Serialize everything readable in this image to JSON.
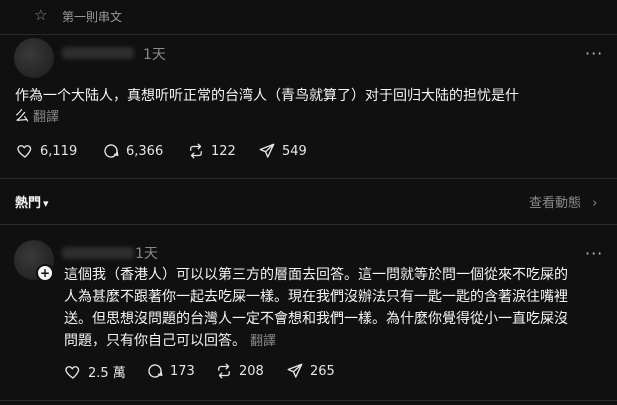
{
  "topbar": {
    "first_label": "第一則串文"
  },
  "post": {
    "time": "1天",
    "more": "···",
    "text_line1": "作為一个大陆人，真想听听正常的台湾人（青鸟就算了）对于回归大陆的担忧是什",
    "text_line2": "么",
    "translate": "翻譯",
    "likes": "6,119",
    "comments": "6,366",
    "reposts": "122",
    "shares": "549"
  },
  "sort": {
    "label": "熱門",
    "view_activity": "查看動態"
  },
  "reply": {
    "time": "1天",
    "text_line1": "這個我（香港人）可以以第三方的層面去回答。這一問就等於問一個從來不吃屎的",
    "text_line2": "人為甚麼不跟著你一起去吃屎一樣。現在我們沒辦法只有一匙一匙的含著淚往嘴裡",
    "text_line3": "送。但思想沒問題的台灣人一定不會想和我們一樣。為什麼你覺得從小一直吃屎沒",
    "text_line4": "問題，只有你自己可以回答。",
    "translate": "翻譯",
    "likes": "2.5 萬",
    "comments": "173",
    "reposts": "208",
    "shares": "265"
  },
  "icons": {
    "star": "star-icon",
    "heart": "heart-icon",
    "comment": "comment-icon",
    "repost": "repost-icon",
    "share": "share-icon",
    "plus": "plus-icon",
    "chevron": "chevron-right-icon"
  }
}
